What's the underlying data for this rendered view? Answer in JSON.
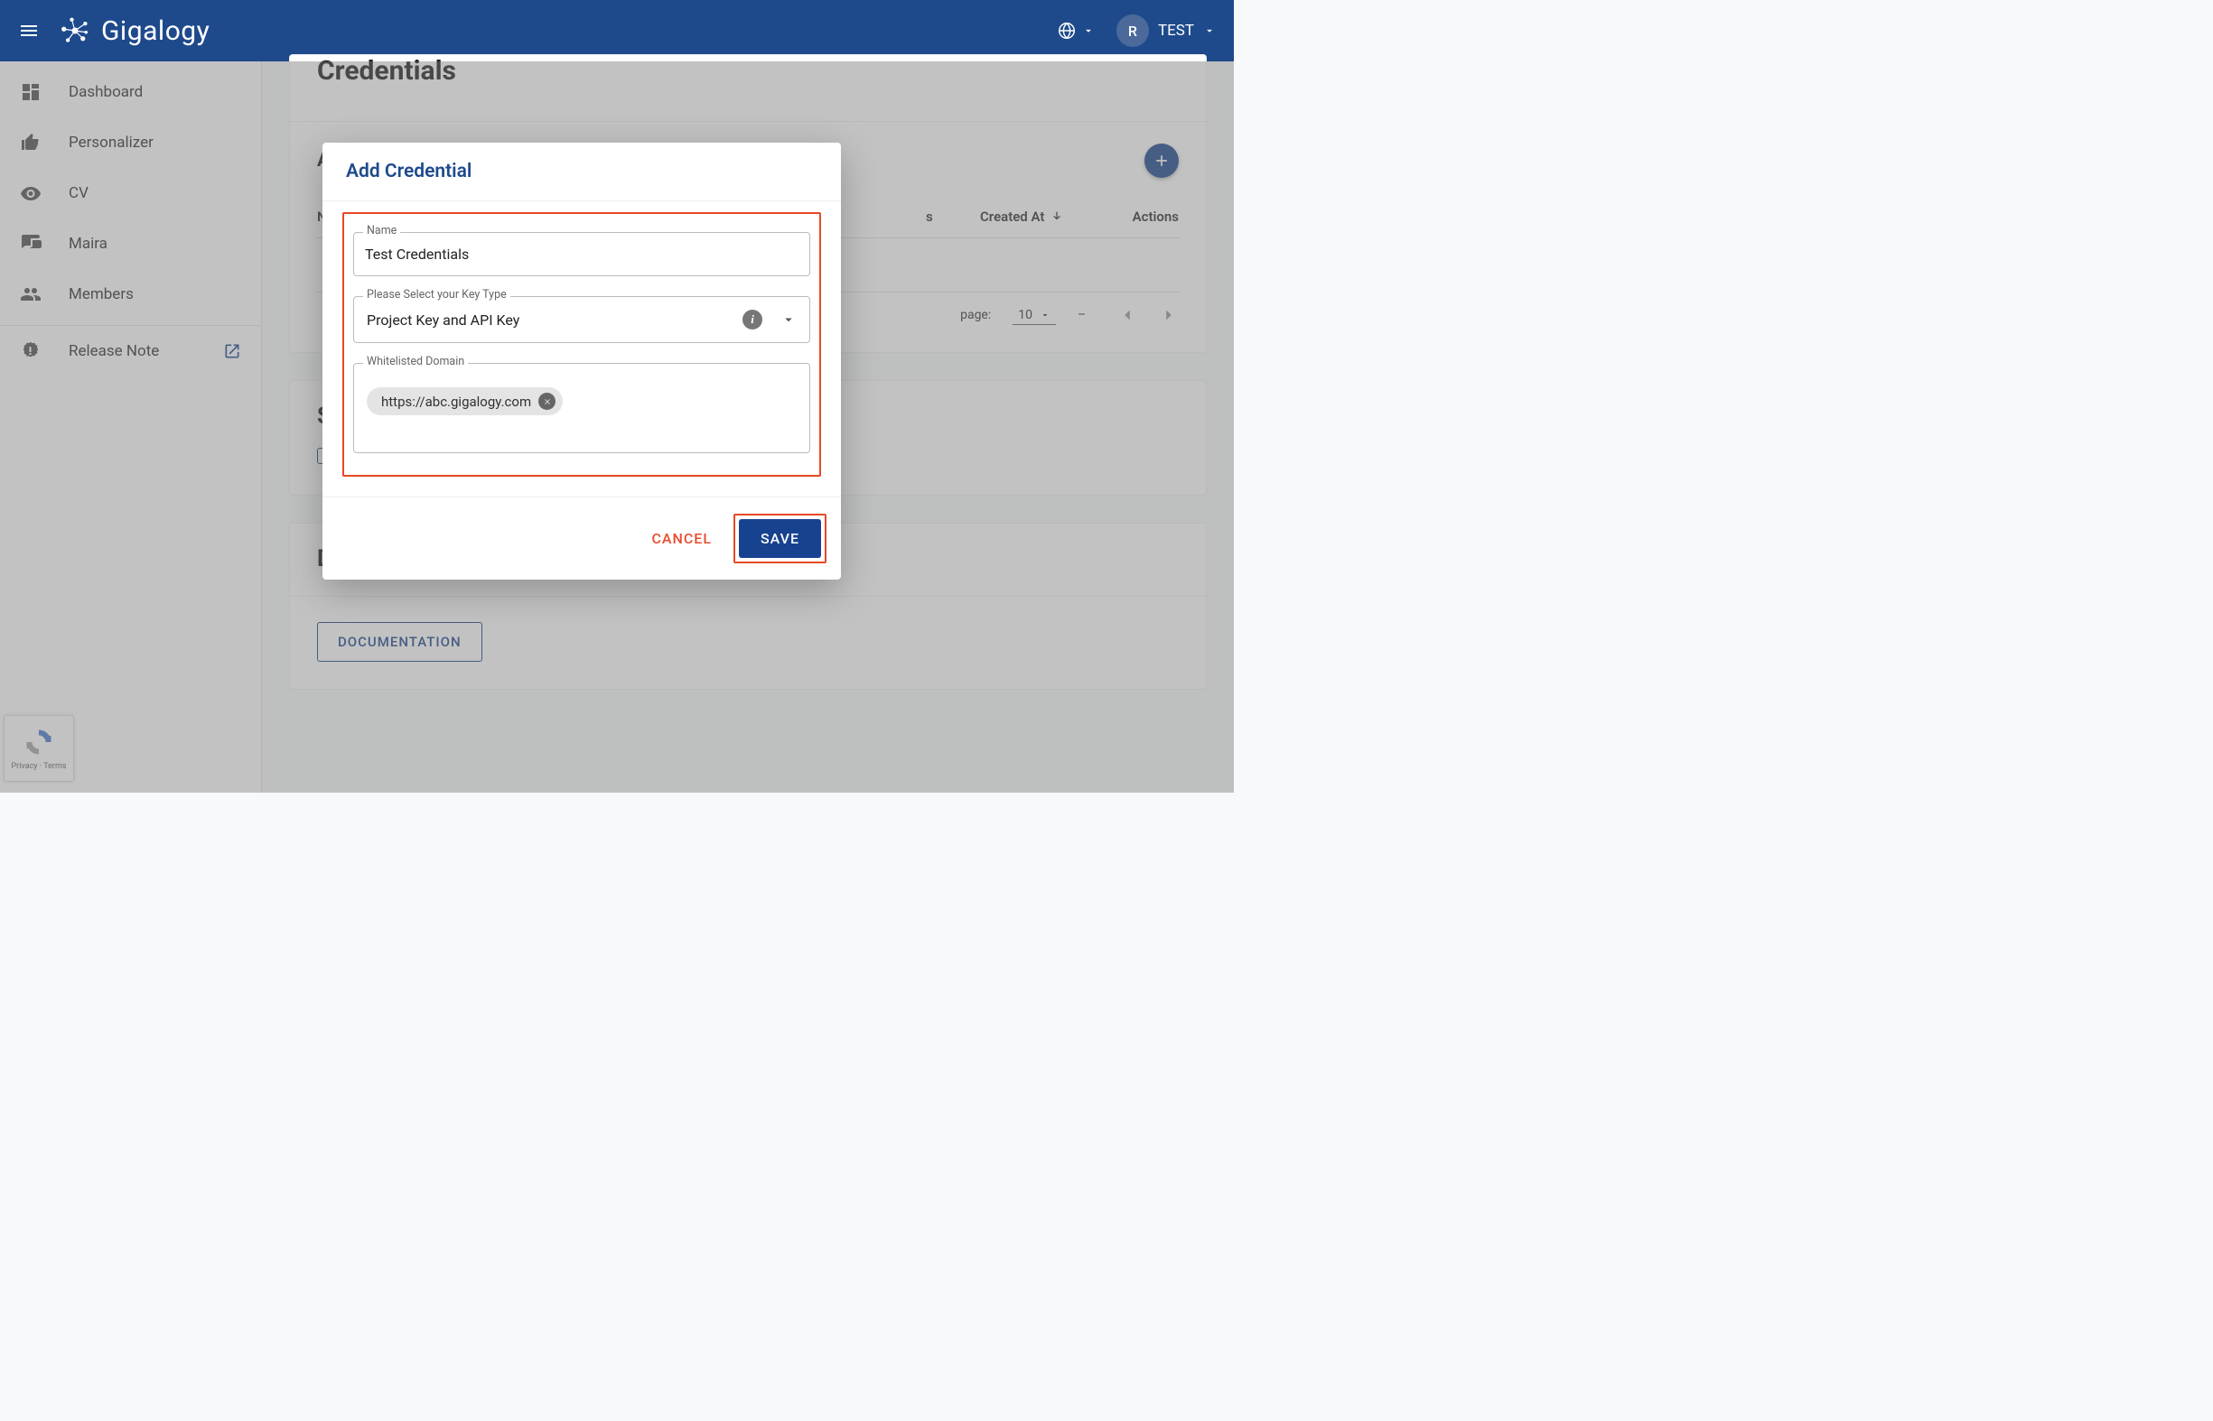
{
  "header": {
    "brand": "Gigalogy",
    "avatar_initial": "R",
    "user_label": "TEST"
  },
  "sidebar": {
    "items": [
      {
        "label": "Dashboard"
      },
      {
        "label": "Personalizer"
      },
      {
        "label": "CV"
      },
      {
        "label": "Maira"
      },
      {
        "label": "Members"
      }
    ],
    "release_note": "Release Note"
  },
  "page": {
    "title": "Credentials",
    "all_credentials": "All Credentials:",
    "doc_section": "Documentation",
    "doc_button": "DOCUMENTATION",
    "subsection_s": "S"
  },
  "table": {
    "col_name": "Name",
    "col_status": "s",
    "col_created": "Created At",
    "col_actions": "Actions",
    "rows_per_page": "page:",
    "rows_value": "10",
    "range": "–"
  },
  "dialog": {
    "title": "Add Credential",
    "name_label": "Name",
    "name_value": "Test Credentials",
    "key_type_label": "Please Select your Key Type",
    "key_type_value": "Project Key and API Key",
    "whitelist_label": "Whitelisted Domain",
    "chip_value": "https://abc.gigalogy.com",
    "cancel": "CANCEL",
    "save": "SAVE"
  },
  "recaptcha": {
    "privacy": "Privacy",
    "terms": "Terms"
  }
}
